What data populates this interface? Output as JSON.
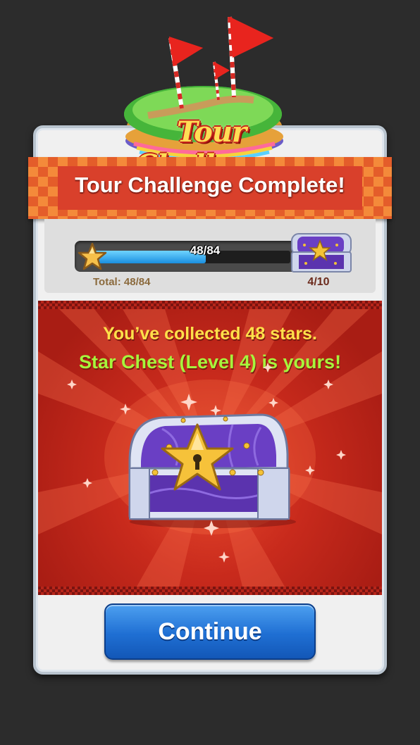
{
  "logo": {
    "text": "Tour Challenge"
  },
  "banner": {
    "title": "Tour Challenge Complete!"
  },
  "progress": {
    "current": 48,
    "total": 84,
    "fraction": 0.571,
    "text": "48/84",
    "total_label": "Total: 48/84",
    "chest_count": "4/10"
  },
  "reward": {
    "line1": "You’ve collected 48 stars.",
    "line2": "Star Chest (Level 4) is yours!"
  },
  "buttons": {
    "continue_label": "Continue"
  },
  "colors": {
    "background": "#2c2c2c",
    "banner": "#e45d2a",
    "reward_bg": "#c82a1c",
    "line1": "#ffe04a",
    "line2": "#a6f53c",
    "button": "#1f6fd3",
    "progress_fill": "#1a8fe0"
  },
  "icons": [
    "flag-icon",
    "star-icon",
    "chest-icon",
    "sparkle-icon"
  ]
}
